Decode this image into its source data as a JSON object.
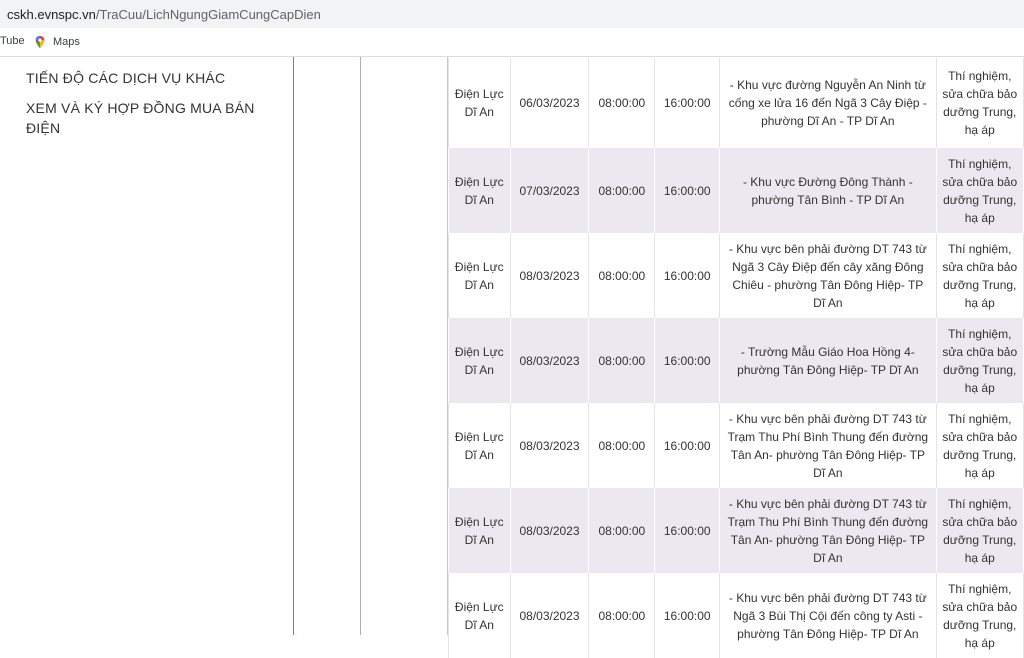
{
  "browser": {
    "url_host": "cskh.evnspc.vn",
    "url_path": "/TraCuu/LichNgungGiamCungCapDien",
    "bookmarks": [
      {
        "label": "Tube",
        "icon": "youtube-icon"
      },
      {
        "label": "Maps",
        "icon": "google-maps-icon"
      }
    ]
  },
  "sidebar": {
    "items": [
      {
        "label": "TIẾN ĐỘ CÁC DỊCH VỤ KHÁC"
      },
      {
        "label": "XEM VÀ KÝ HỢP ĐỒNG MUA BÁN ĐIỆN"
      }
    ]
  },
  "colors": {
    "row_alt": "#ece8ef",
    "divider": "#8e6fa8"
  },
  "schedule": {
    "rows": [
      {
        "unit": "Điện Lực Dĩ An",
        "date": "06/03/2023",
        "start": "08:00:00",
        "end": "16:00:00",
        "area": "- Khu vực đường Nguyễn An Ninh từ cống xe lửa 16 đến Ngã 3 Cây Điệp - phường Dĩ An - TP Dĩ An",
        "work": "Thí nghiệm, sửa chữa bảo dưỡng Trung, hạ áp"
      },
      {
        "unit": "Điện Lực Dĩ An",
        "date": "07/03/2023",
        "start": "08:00:00",
        "end": "16:00:00",
        "area": "- Khu vực Đường Đông Thành - phường Tân Bình - TP Dĩ An",
        "work": "Thí nghiệm, sửa chữa bảo dưỡng Trung, hạ áp"
      },
      {
        "unit": "Điện Lực Dĩ An",
        "date": "08/03/2023",
        "start": "08:00:00",
        "end": "16:00:00",
        "area": "- Khu vực bên phải đường DT 743 từ Ngã 3 Cây Điệp đến cây xăng Đông Chiêu - phường Tân Đông Hiệp- TP Dĩ An",
        "work": "Thí nghiệm, sửa chữa bảo dưỡng Trung, hạ áp"
      },
      {
        "unit": "Điện Lực Dĩ An",
        "date": "08/03/2023",
        "start": "08:00:00",
        "end": "16:00:00",
        "area": "- Trường Mẫu Giáo Hoa Hồng 4- phường Tân Đông Hiệp- TP Dĩ An",
        "work": "Thí nghiệm, sửa chữa bảo dưỡng Trung, hạ áp"
      },
      {
        "unit": "Điện Lực Dĩ An",
        "date": "08/03/2023",
        "start": "08:00:00",
        "end": "16:00:00",
        "area": "- Khu vực bên phải đường DT 743 từ Trạm Thu Phí Bình Thung đến đường Tân An- phường Tân Đông Hiệp- TP Dĩ An",
        "work": "Thí nghiệm, sửa chữa bảo dưỡng Trung, hạ áp"
      },
      {
        "unit": "Điện Lực Dĩ An",
        "date": "08/03/2023",
        "start": "08:00:00",
        "end": "16:00:00",
        "area": "- Khu vực bên phải đường DT 743 từ Trạm Thu Phí Bình Thung đến đường Tân An- phường Tân Đông Hiệp- TP Dĩ An",
        "work": "Thí nghiệm, sửa chữa bảo dưỡng Trung, hạ áp"
      },
      {
        "unit": "Điện Lực Dĩ An",
        "date": "08/03/2023",
        "start": "08:00:00",
        "end": "16:00:00",
        "area": "- Khu vực bên phải đường DT 743 từ Ngã 3 Bùi Thị Cội đến công ty Asti - phường Tân Đông Hiệp- TP Dĩ An",
        "work": "Thí nghiệm, sửa chữa bảo dưỡng Trung, hạ áp"
      }
    ]
  }
}
